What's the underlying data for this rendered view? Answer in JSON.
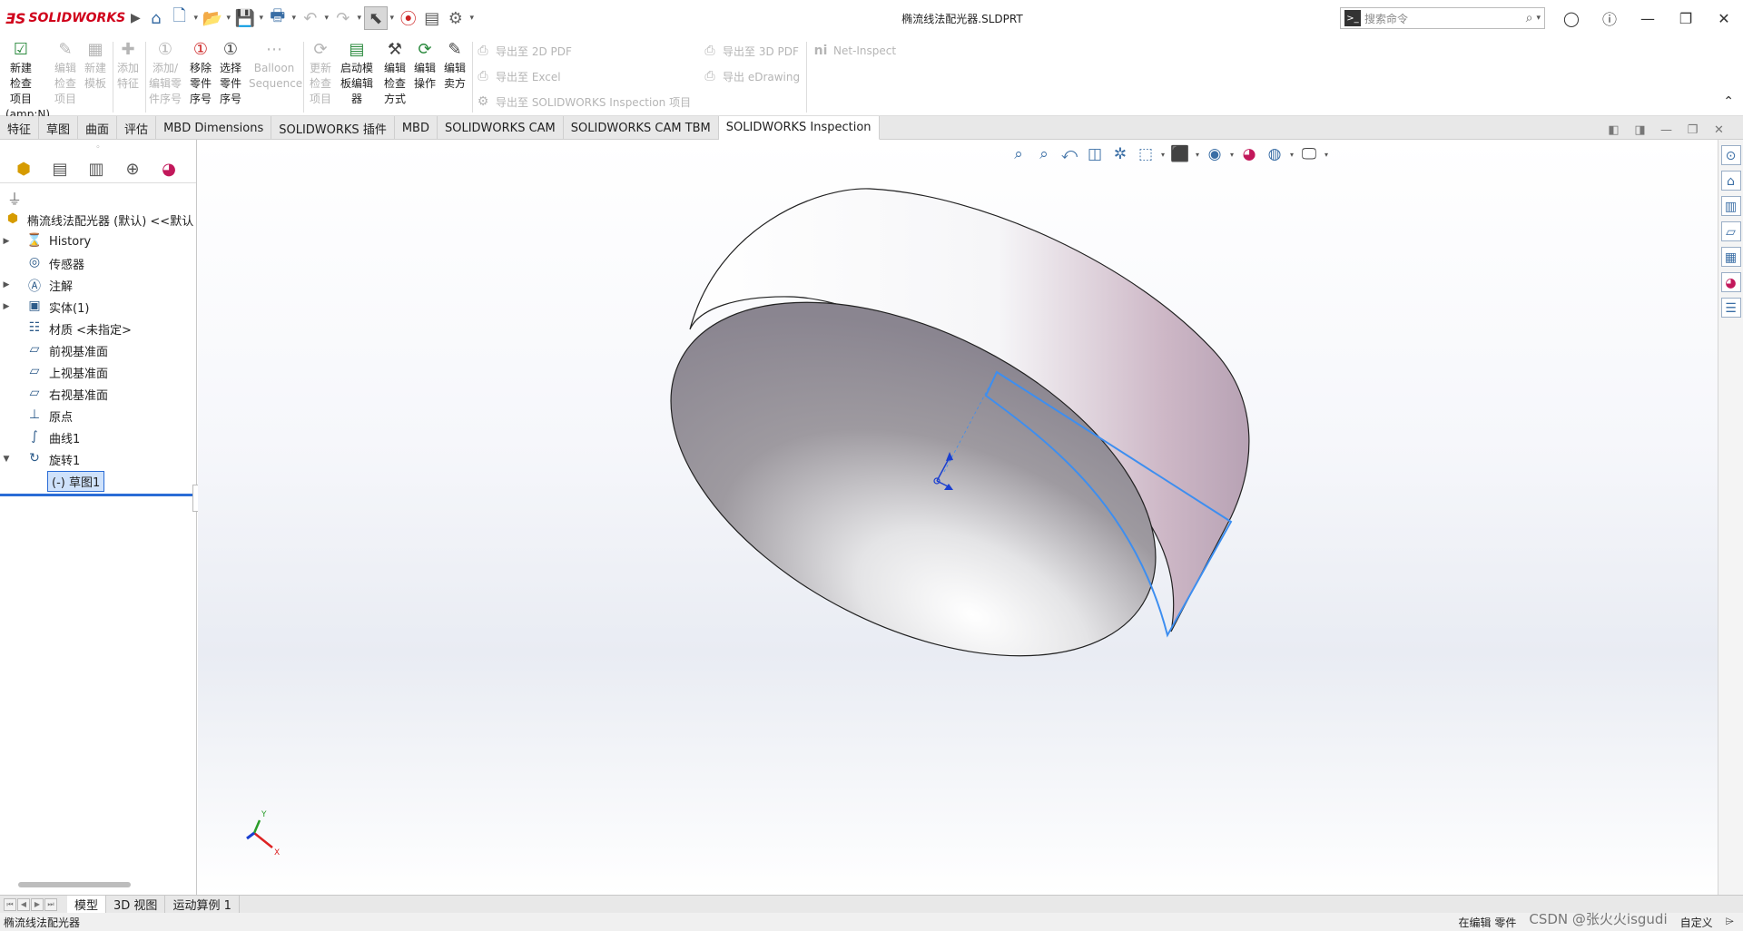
{
  "app": {
    "brand": "SOLIDWORKS",
    "doc_title": "椭流线法配光器.SLDPRT"
  },
  "search": {
    "placeholder": "搜索命令"
  },
  "ribbon": {
    "buttons": [
      {
        "label": "新建检查项目(amp;N)",
        "enabled": true
      },
      {
        "label": "编辑检查项目",
        "enabled": false
      },
      {
        "label": "新建模板",
        "enabled": false
      },
      {
        "label": "添加特征",
        "enabled": false
      },
      {
        "label": "添加/编辑零件序号",
        "enabled": false
      },
      {
        "label": "移除零件序号",
        "enabled": true
      },
      {
        "label": "选择零件序号",
        "enabled": true
      },
      {
        "label": "Balloon Sequence",
        "enabled": false
      },
      {
        "label": "更新检查项目",
        "enabled": false
      },
      {
        "label": "启动模板编辑器",
        "enabled": true
      },
      {
        "label": "编辑检查方式",
        "enabled": true
      },
      {
        "label": "编辑操作",
        "enabled": true
      },
      {
        "label": "编辑卖方",
        "enabled": true
      }
    ],
    "export_2d_pdf": "导出至 2D PDF",
    "export_excel": "导出至 Excel",
    "export_inspection": "导出至 SOLIDWORKS Inspection 项目",
    "export_3d_pdf": "导出至 3D PDF",
    "export_edrawing": "导出 eDrawing",
    "net_inspect": "Net-Inspect"
  },
  "tabs": [
    {
      "label": "特征",
      "active": false
    },
    {
      "label": "草图",
      "active": false
    },
    {
      "label": "曲面",
      "active": false
    },
    {
      "label": "评估",
      "active": false
    },
    {
      "label": "MBD Dimensions",
      "active": false
    },
    {
      "label": "SOLIDWORKS 插件",
      "active": false
    },
    {
      "label": "MBD",
      "active": false
    },
    {
      "label": "SOLIDWORKS CAM",
      "active": false
    },
    {
      "label": "SOLIDWORKS CAM TBM",
      "active": false
    },
    {
      "label": "SOLIDWORKS Inspection",
      "active": true
    }
  ],
  "tree": {
    "root": "椭流线法配光器 (默认) <<默认",
    "items": [
      {
        "label": "History",
        "expandable": true,
        "icon": "history-icon"
      },
      {
        "label": "传感器",
        "expandable": false,
        "icon": "sensor-icon"
      },
      {
        "label": "注解",
        "expandable": true,
        "icon": "annotation-icon"
      },
      {
        "label": "实体(1)",
        "expandable": true,
        "icon": "solid-body-icon"
      },
      {
        "label": "材质 <未指定>",
        "expandable": false,
        "icon": "material-icon"
      },
      {
        "label": "前视基准面",
        "expandable": false,
        "icon": "plane-icon"
      },
      {
        "label": "上视基准面",
        "expandable": false,
        "icon": "plane-icon"
      },
      {
        "label": "右视基准面",
        "expandable": false,
        "icon": "plane-icon"
      },
      {
        "label": "原点",
        "expandable": false,
        "icon": "origin-icon"
      },
      {
        "label": "曲线1",
        "expandable": false,
        "icon": "curve-icon"
      },
      {
        "label": "旋转1",
        "expandable": true,
        "expanded": true,
        "icon": "revolve-icon"
      }
    ],
    "child": "(-) 草图1"
  },
  "triad": {
    "y": "Y",
    "x": "X"
  },
  "bottom_tabs": [
    {
      "label": "模型",
      "active": true
    },
    {
      "label": "3D 视图",
      "active": false
    },
    {
      "label": "运动算例 1",
      "active": false
    }
  ],
  "status": {
    "left": "椭流线法配光器",
    "editing": "在编辑 零件",
    "custom": "自定义",
    "watermark": "CSDN @张火火isgudi"
  },
  "colors": {
    "accent": "#2a6cd6",
    "brand": "#d0021b",
    "sketch": "#3d8ef0"
  }
}
